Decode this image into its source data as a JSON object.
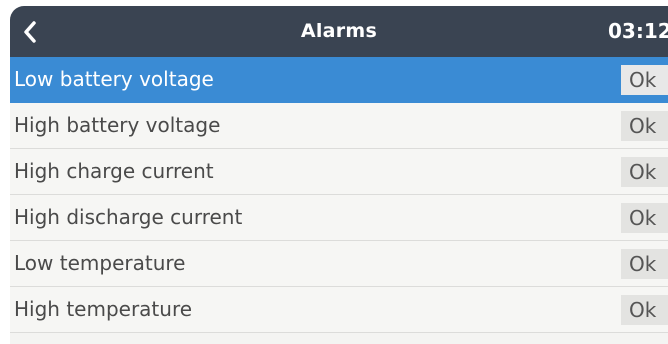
{
  "header": {
    "back_icon": "chevron-left-icon",
    "title": "Alarms",
    "time": "03:12"
  },
  "alarms": [
    {
      "label": "Low battery voltage",
      "value": "Ok",
      "selected": true
    },
    {
      "label": "High battery voltage",
      "value": "Ok",
      "selected": false
    },
    {
      "label": "High charge current",
      "value": "Ok",
      "selected": false
    },
    {
      "label": "High discharge current",
      "value": "Ok",
      "selected": false
    },
    {
      "label": "Low temperature",
      "value": "Ok",
      "selected": false
    },
    {
      "label": "High temperature",
      "value": "Ok",
      "selected": false
    }
  ],
  "colors": {
    "header_bg": "#3a4452",
    "selected_bg": "#3a8bd4",
    "row_bg": "#f6f6f4"
  }
}
